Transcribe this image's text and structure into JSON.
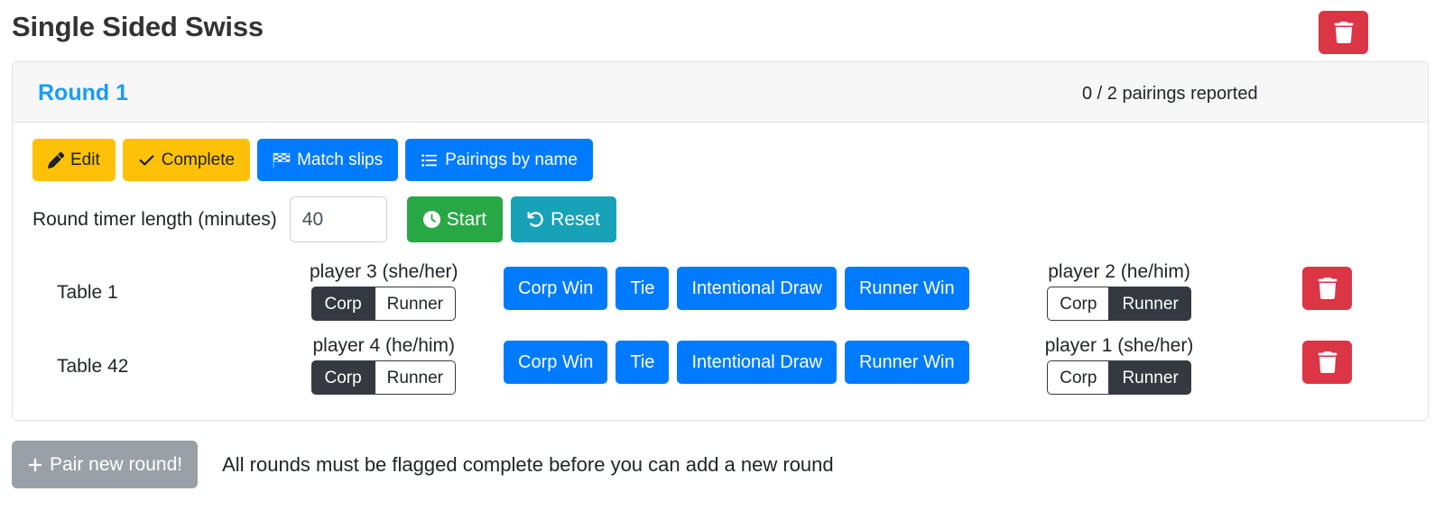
{
  "header": {
    "title": "Single Sided Swiss",
    "delete_tournament_icon": "trash-icon"
  },
  "round_card": {
    "round_label": "Round 1",
    "pairings_reported": "0 / 2 pairings reported",
    "toolbar": [
      {
        "label": "Edit",
        "icon": "pencil-icon",
        "style": "warning"
      },
      {
        "label": "Complete",
        "icon": "check-icon",
        "style": "warning"
      },
      {
        "label": "Match slips",
        "icon": "checkered-flag-icon",
        "style": "primary"
      },
      {
        "label": "Pairings by name",
        "icon": "list-ul-icon",
        "style": "primary"
      }
    ],
    "timer": {
      "label": "Round timer length (minutes)",
      "value": "40",
      "placeholder": "",
      "start_label": "Start",
      "start_icon": "clock-icon",
      "reset_label": "Reset",
      "reset_icon": "undo-icon"
    },
    "result_buttons": [
      "Corp Win",
      "Tie",
      "Intentional Draw",
      "Runner Win"
    ],
    "side_labels": {
      "corp": "Corp",
      "runner": "Runner"
    },
    "rows": [
      {
        "table": "Table 1",
        "left_player": {
          "name": "player 3 (she/her)",
          "side": "corp"
        },
        "right_player": {
          "name": "player 2 (he/him)",
          "side": "runner"
        },
        "delete_icon": "trash-icon"
      },
      {
        "table": "Table 42",
        "left_player": {
          "name": "player 4 (he/him)",
          "side": "corp"
        },
        "right_player": {
          "name": "player 1 (she/her)",
          "side": "runner"
        },
        "delete_icon": "trash-icon"
      }
    ]
  },
  "footer": {
    "pair_button_label": "Pair new round!",
    "pair_button_icon": "plus-icon",
    "note": "All rounds must be flagged complete before you can add a new round"
  },
  "colors": {
    "accent_blue": "#007bff",
    "link_blue": "#1a9bfc",
    "warning_yellow": "#ffc107",
    "danger_red": "#dc3545",
    "success_green": "#28a745",
    "info_teal": "#17a2b8",
    "dark": "#343a40",
    "secondary_gray": "#9aa0a6"
  }
}
